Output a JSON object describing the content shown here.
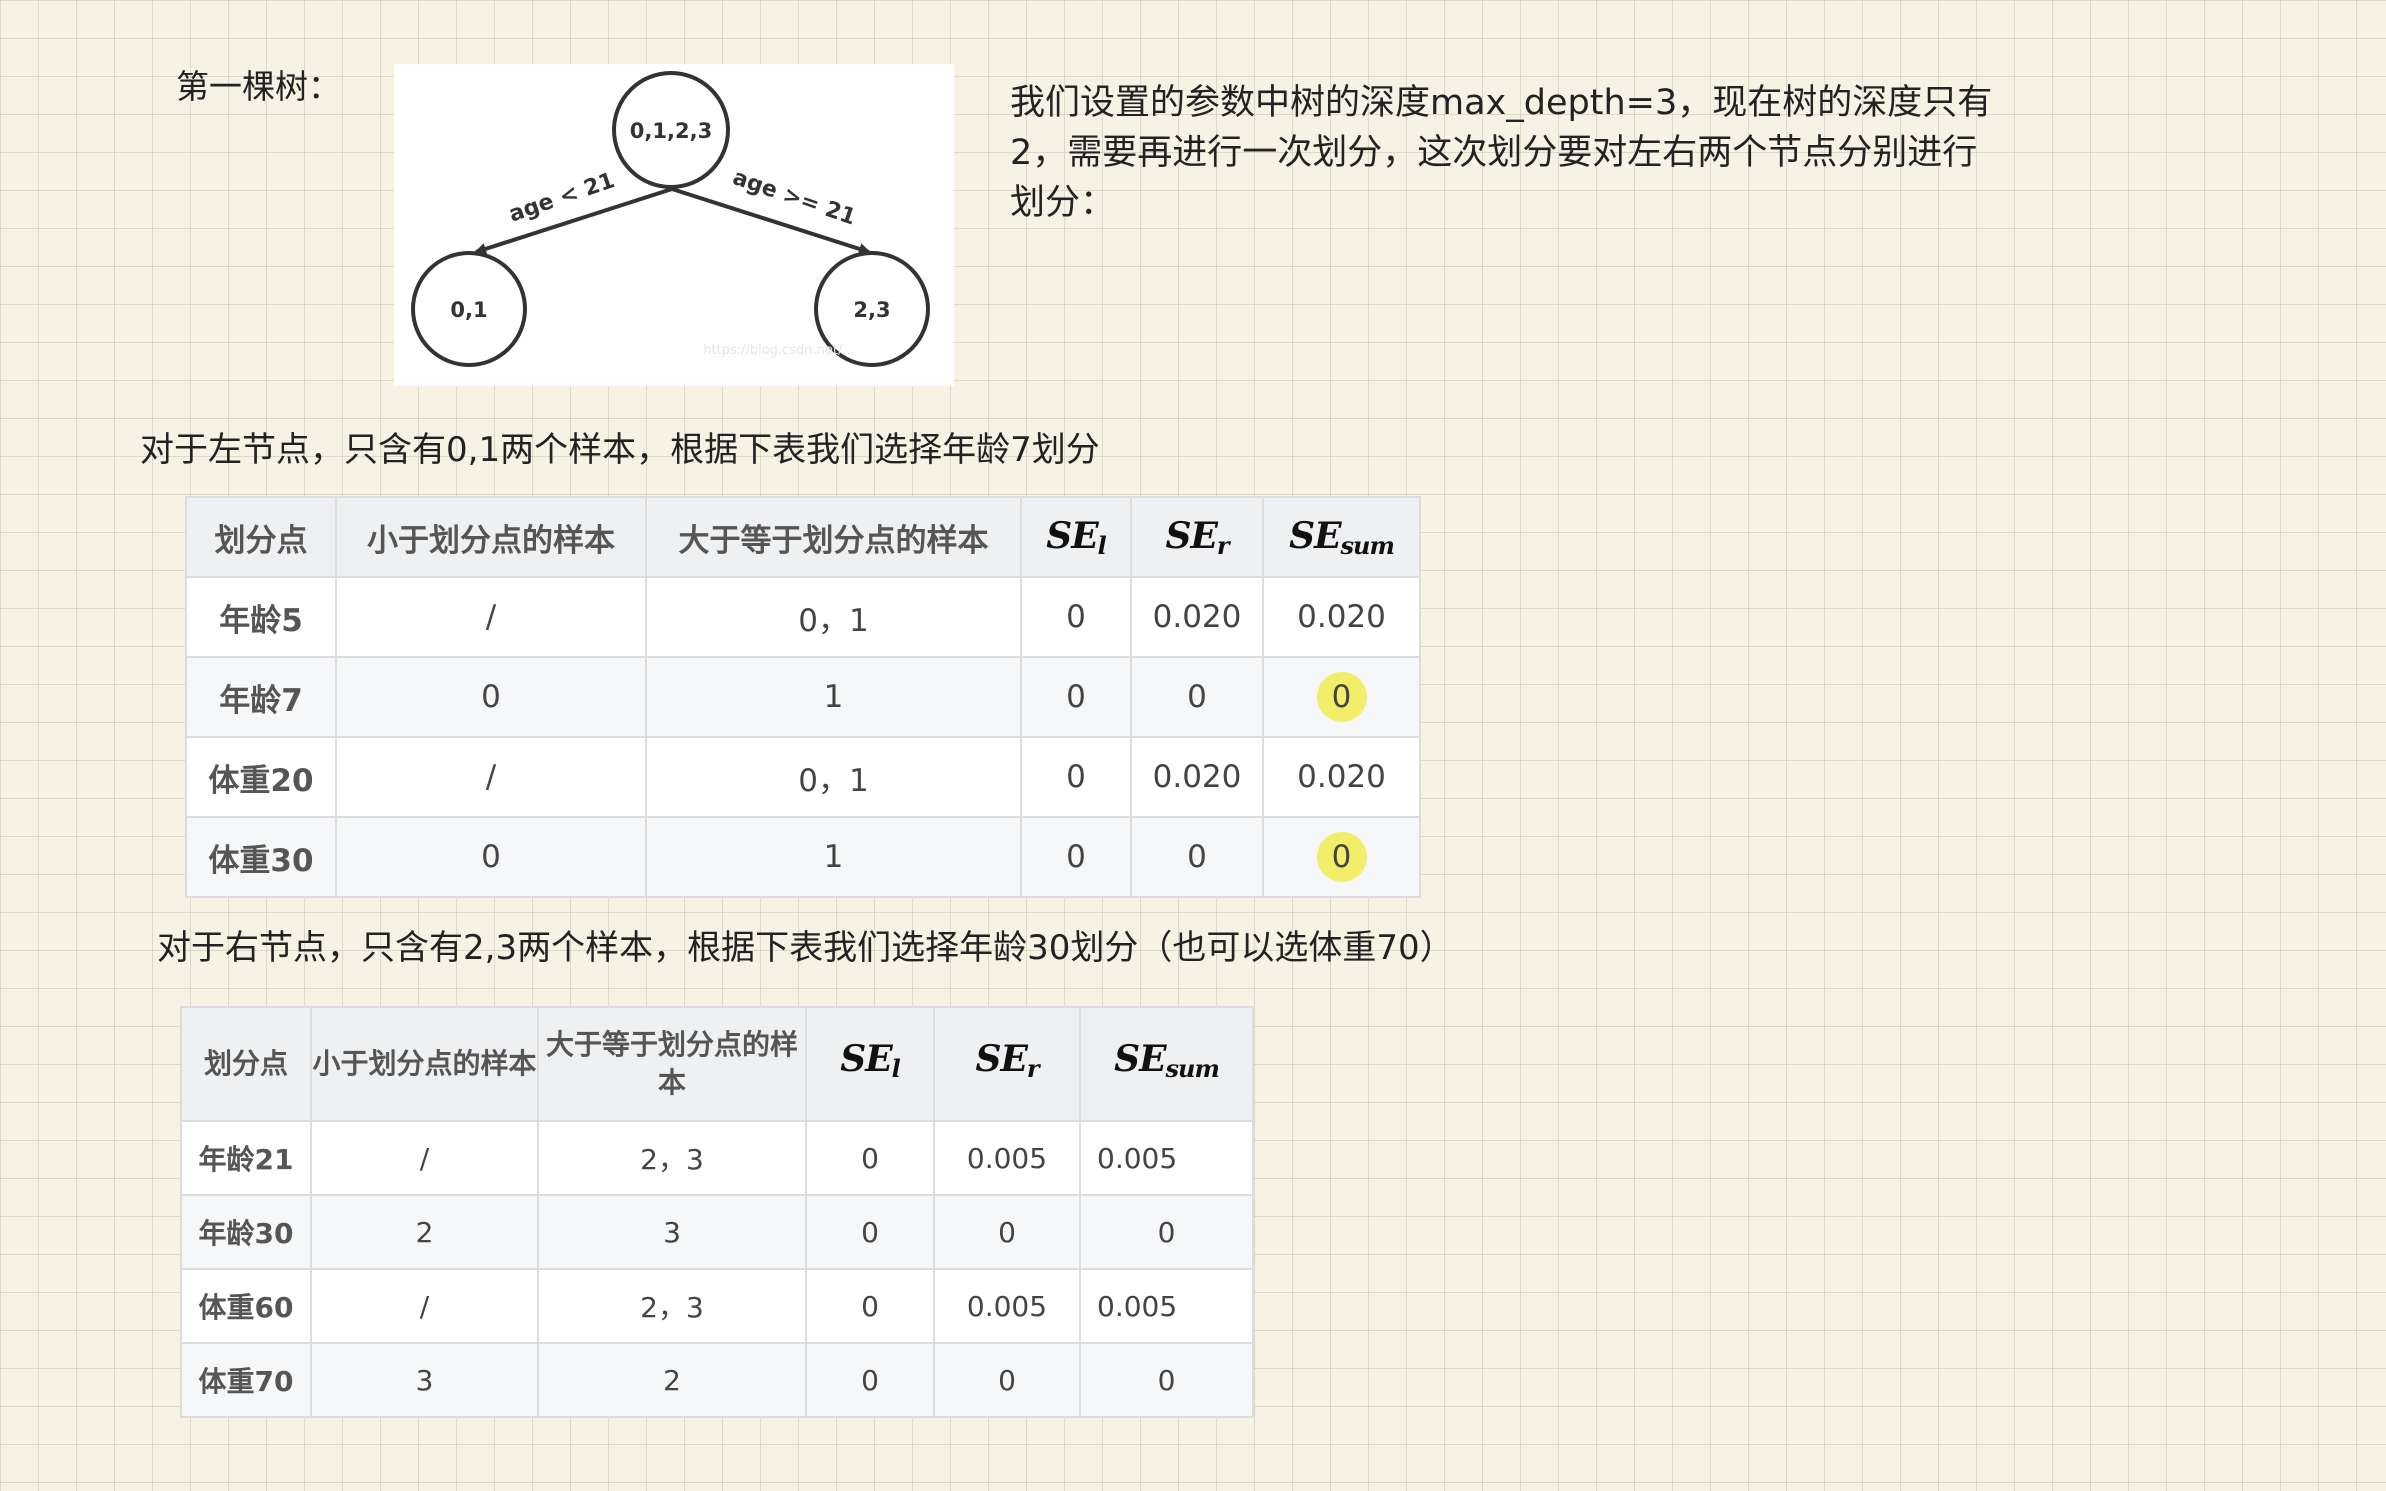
{
  "tree_label": "第一棵树：",
  "tree": {
    "root": "0,1,2,3",
    "left": "0,1",
    "right": "2,3",
    "left_edge": "age < 21",
    "right_edge": "age >= 21",
    "watermark": "https://blog.csdn.net/..."
  },
  "intro": "我们设置的参数中树的深度max_depth=3，现在树的深度只有2，需要再进行一次划分，这次划分要对左右两个节点分别进行划分：",
  "left_caption": "对于左节点，只含有0,1两个样本，根据下表我们选择年龄7划分",
  "left_table": {
    "headers": [
      "划分点",
      "小于划分点的样本",
      "大于等于划分点的样本"
    ],
    "hand_headers": [
      {
        "base": "SE",
        "sub": "l"
      },
      {
        "base": "SE",
        "sub": "r"
      },
      {
        "base": "SE",
        "sub": "sum"
      }
    ],
    "rows": [
      {
        "point": "年龄5",
        "less": "/",
        "ge": "0，1",
        "sel": "0",
        "ser": "0.020",
        "sesum": "0.020"
      },
      {
        "point": "年龄7",
        "less": "0",
        "ge": "1",
        "sel": "0",
        "ser": "0",
        "sesum": "0"
      },
      {
        "point": "体重20",
        "less": "/",
        "ge": "0，1",
        "sel": "0",
        "ser": "0.020",
        "sesum": "0.020"
      },
      {
        "point": "体重30",
        "less": "0",
        "ge": "1",
        "sel": "0",
        "ser": "0",
        "sesum": "0"
      }
    ]
  },
  "right_caption": "对于右节点，只含有2,3两个样本，根据下表我们选择年龄30划分（也可以选体重70）",
  "right_table": {
    "headers": [
      "划分点",
      "小于划分点的样本",
      "大于等于划分点的样本"
    ],
    "hand_headers": [
      {
        "base": "SE",
        "sub": "l"
      },
      {
        "base": "SE",
        "sub": "r"
      },
      {
        "base": "SE",
        "sub": "sum"
      }
    ],
    "rows": [
      {
        "point": "年龄21",
        "less": "/",
        "ge": "2，3",
        "sel": "0",
        "ser": "0.005",
        "sesum": "0.005"
      },
      {
        "point": "年龄30",
        "less": "2",
        "ge": "3",
        "sel": "0",
        "ser": "0",
        "sesum": "0"
      },
      {
        "point": "体重60",
        "less": "/",
        "ge": "2，3",
        "sel": "0",
        "ser": "0.005",
        "sesum": "0.005"
      },
      {
        "point": "体重70",
        "less": "3",
        "ge": "2",
        "sel": "0",
        "ser": "0",
        "sesum": "0"
      }
    ]
  },
  "colors": {
    "highlight": "#f2ee6a",
    "grid_paper": "#f6f3e4"
  }
}
